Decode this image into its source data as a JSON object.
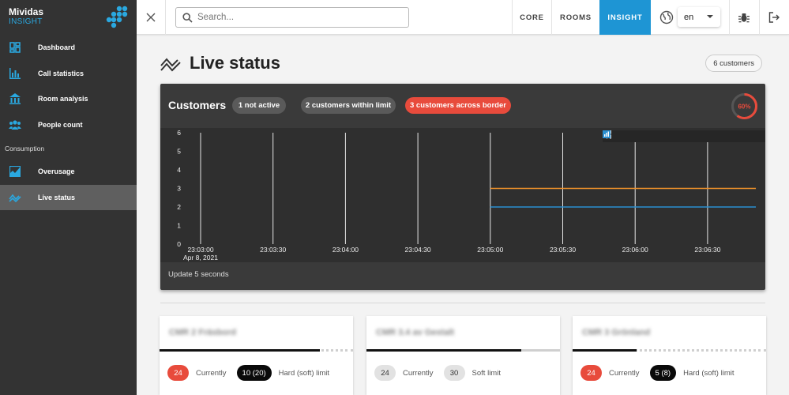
{
  "app": {
    "name": "Mividas",
    "product": "INSIGHT"
  },
  "sidebar": {
    "items": [
      {
        "label": "Dashboard",
        "icon": "dashboard-icon"
      },
      {
        "label": "Call statistics",
        "icon": "bar-chart-icon"
      },
      {
        "label": "Room analysis",
        "icon": "building-icon"
      },
      {
        "label": "People count",
        "icon": "people-icon"
      }
    ],
    "section": "Consumption",
    "section_items": [
      {
        "label": "Overusage",
        "icon": "area-chart-icon"
      },
      {
        "label": "Live status",
        "icon": "trend-icon",
        "active": true
      }
    ]
  },
  "topbar": {
    "search_placeholder": "Search...",
    "tabs": [
      {
        "label": "CORE"
      },
      {
        "label": "ROOMS"
      },
      {
        "label": "INSIGHT",
        "active": true
      }
    ],
    "language": "en"
  },
  "page": {
    "title": "Live status",
    "customers_badge": "6 customers"
  },
  "card": {
    "title": "Customers",
    "chips": [
      "1 not active",
      "2 customers within limit",
      "3 customers across border"
    ],
    "gauge_label": "60%",
    "gauge_value": 0.6,
    "update_text": "Update 5 seconds"
  },
  "chart_data": {
    "type": "line",
    "x_ticks": [
      "23:03:00",
      "23:03:30",
      "23:04:00",
      "23:04:30",
      "23:05:00",
      "23:05:30",
      "23:06:00",
      "23:06:30"
    ],
    "x_date_label": "Apr 8, 2021",
    "y_ticks": [
      0,
      1,
      2,
      3,
      4,
      5,
      6
    ],
    "ylim": [
      0,
      6
    ],
    "series": [
      {
        "color": "#f0922b",
        "x": [
          "23:05:00",
          "23:06:50"
        ],
        "y": [
          3,
          3
        ]
      },
      {
        "color": "#2a8fd0",
        "x": [
          "23:05:00",
          "23:06:50"
        ],
        "y": [
          2,
          2
        ]
      }
    ],
    "grid": true,
    "background": "#2f2f2f"
  },
  "rooms": [
    {
      "name": "CMR 2 Fräsbord",
      "current": "24",
      "limit": "10 (20)",
      "limit_label": "Hard (soft) limit",
      "current_label": "Currently",
      "fill": 0.83,
      "style": "dotted"
    },
    {
      "name": "CMR 3.4 av Gestalt",
      "current": "24",
      "limit": "30",
      "limit_label": "Soft limit",
      "current_label": "Currently",
      "fill": 0.8,
      "style": "solid"
    },
    {
      "name": "CMR 3 Grönland",
      "current": "24",
      "limit": "5 (8)",
      "limit_label": "Hard (soft) limit",
      "current_label": "Currently",
      "fill": 0.33,
      "style": "dotted"
    }
  ],
  "colors": {
    "accent": "#1e95d4",
    "danger": "#e84b3c",
    "sidebar": "#333333",
    "orange": "#f0922b"
  }
}
